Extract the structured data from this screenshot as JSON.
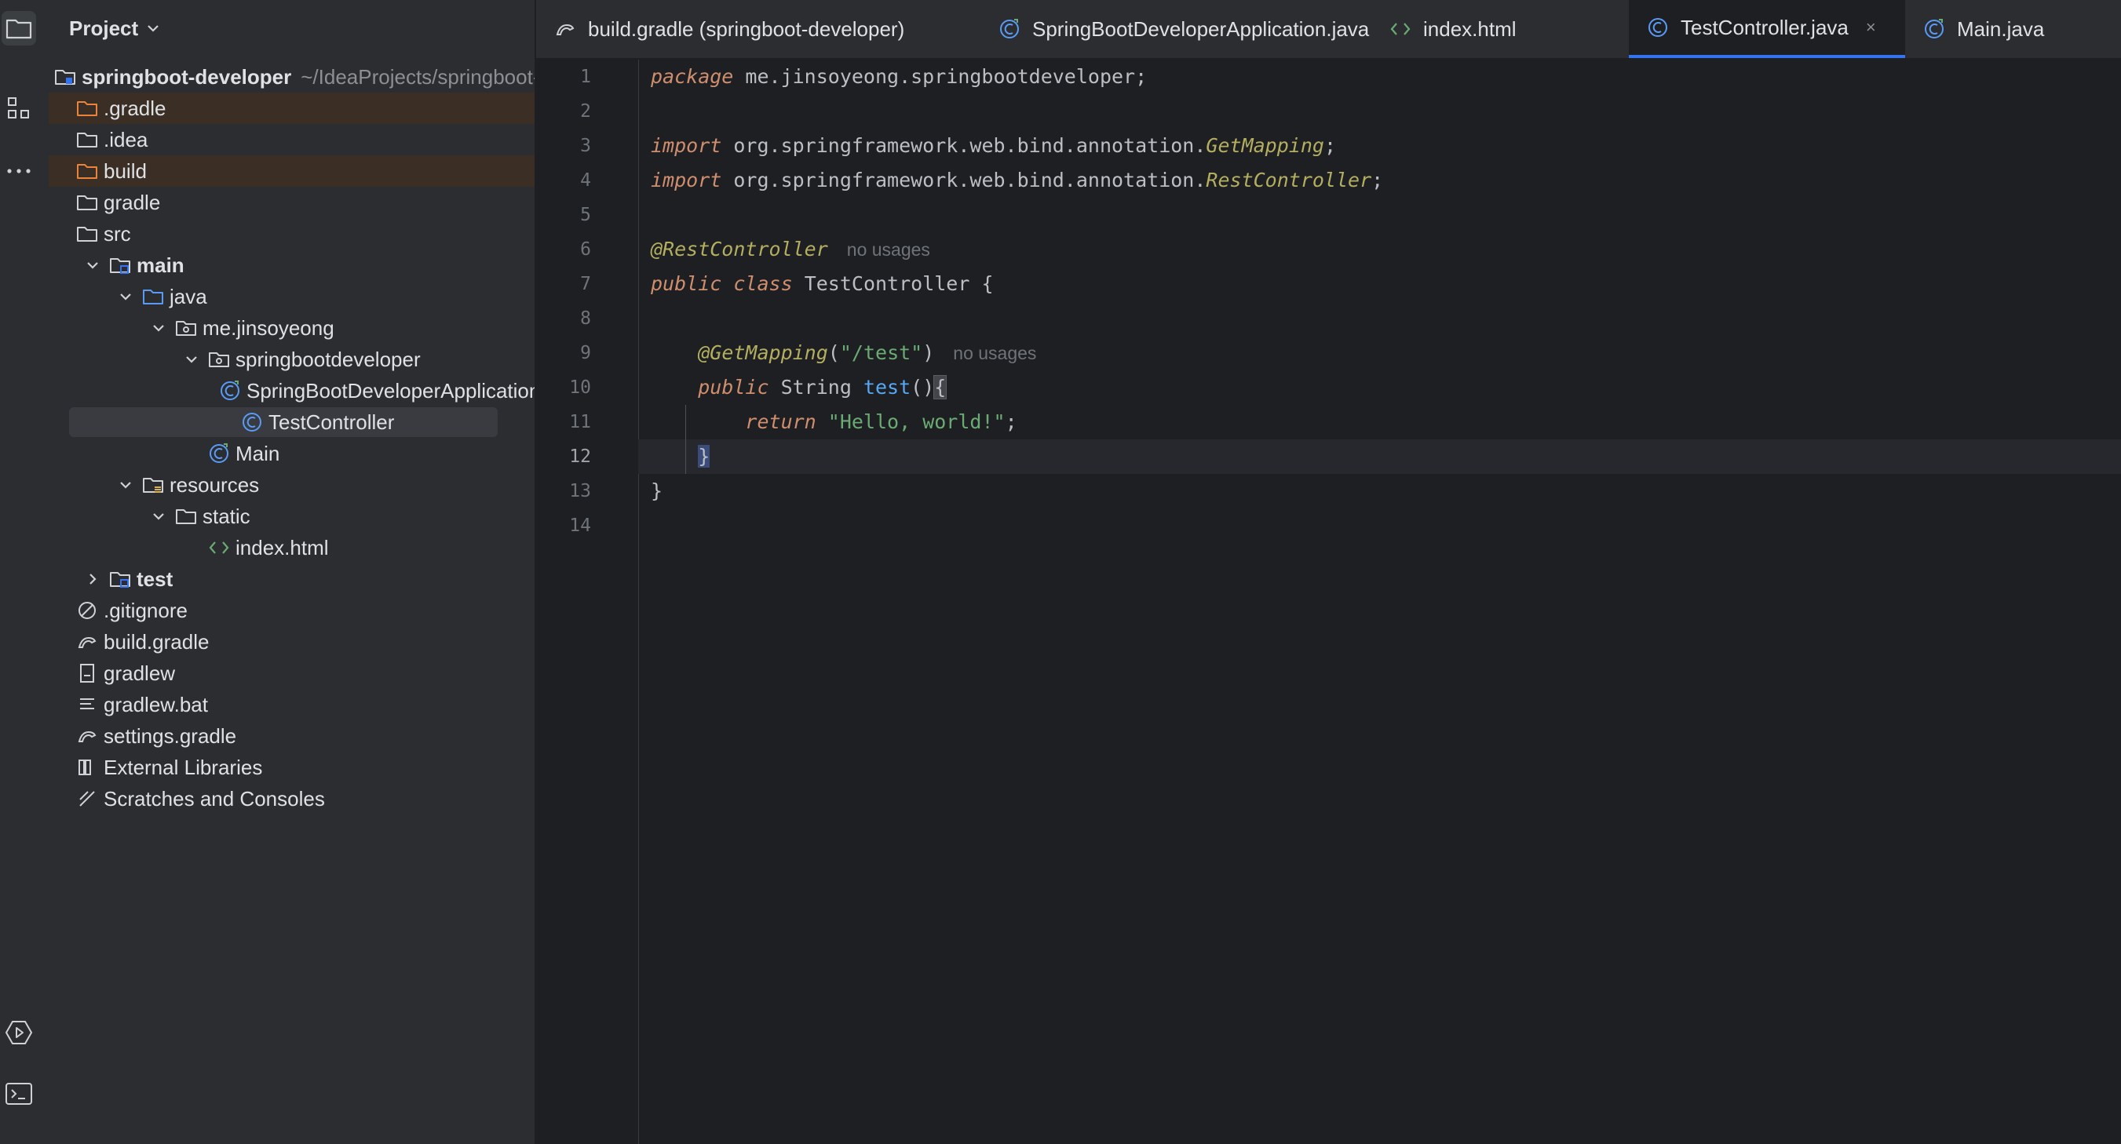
{
  "project_panel": {
    "title": "Project",
    "tree": [
      {
        "label": "springboot-developer",
        "path": "~/IdeaProjects/springboot-d",
        "depth": 0,
        "icon": "module-folder-icon",
        "bold": true,
        "excluded": false
      },
      {
        "label": ".gradle",
        "depth": 0,
        "icon": "folder-orange-icon",
        "excluded": true
      },
      {
        "label": ".idea",
        "depth": 0,
        "icon": "folder-icon"
      },
      {
        "label": "build",
        "depth": 0,
        "icon": "folder-orange-icon",
        "excluded": true
      },
      {
        "label": "gradle",
        "depth": 0,
        "icon": "folder-icon"
      },
      {
        "label": "src",
        "depth": 0,
        "icon": "folder-icon"
      },
      {
        "label": "main",
        "depth": 1,
        "icon": "source-root-folder-icon",
        "bold": true,
        "expanded": true
      },
      {
        "label": "java",
        "depth": 2,
        "icon": "java-source-folder-icon",
        "expanded": true
      },
      {
        "label": "me.jinsoyeong",
        "depth": 3,
        "icon": "package-icon",
        "expanded": true
      },
      {
        "label": "springbootdeveloper",
        "depth": 4,
        "icon": "package-icon",
        "expanded": true
      },
      {
        "label": "SpringBootDeveloperApplication",
        "depth": 5,
        "icon": "spring-boot-class-icon"
      },
      {
        "label": "TestController",
        "depth": 5,
        "icon": "java-class-icon",
        "selected": true
      },
      {
        "label": "Main",
        "depth": 4,
        "icon": "spring-boot-class-icon"
      },
      {
        "label": "resources",
        "depth": 2,
        "icon": "resources-folder-icon",
        "expanded": true
      },
      {
        "label": "static",
        "depth": 3,
        "icon": "folder-icon",
        "expanded": true
      },
      {
        "label": "index.html",
        "depth": 4,
        "icon": "html-file-icon"
      },
      {
        "label": "test",
        "depth": 1,
        "icon": "source-root-folder-icon",
        "bold": true,
        "expanded": false
      },
      {
        "label": ".gitignore",
        "depth": 0,
        "icon": "ignore-file-icon"
      },
      {
        "label": "build.gradle",
        "depth": 0,
        "icon": "gradle-file-icon"
      },
      {
        "label": "gradlew",
        "depth": 0,
        "icon": "file-icon"
      },
      {
        "label": "gradlew.bat",
        "depth": 0,
        "icon": "text-file-icon"
      },
      {
        "label": "settings.gradle",
        "depth": 0,
        "icon": "gradle-file-icon"
      },
      {
        "label": "External Libraries",
        "depth": 0,
        "icon": "libraries-icon"
      },
      {
        "label": "Scratches and Consoles",
        "depth": 0,
        "icon": "scratches-icon"
      }
    ]
  },
  "tabs": [
    {
      "label": "build.gradle (springboot-developer)",
      "icon": "gradle-file-icon",
      "active": false
    },
    {
      "label": "SpringBootDeveloperApplication.java",
      "icon": "spring-boot-class-icon",
      "active": false
    },
    {
      "label": "index.html",
      "icon": "html-file-icon",
      "active": false
    },
    {
      "label": "TestController.java",
      "icon": "java-class-icon",
      "active": true,
      "close": "×"
    },
    {
      "label": "Main.java",
      "icon": "spring-boot-class-icon",
      "active": false
    }
  ],
  "editor": {
    "current_line": 12,
    "line_numbers": [
      "1",
      "2",
      "3",
      "4",
      "5",
      "6",
      "7",
      "8",
      "9",
      "10",
      "11",
      "12",
      "13",
      "14"
    ],
    "lines": {
      "l1": {
        "kw": "package",
        "rest": " me.jinsoyeong.springbootdeveloper;"
      },
      "l3": {
        "kw": "import",
        "pkg": " org.springframework.web.bind.annotation.",
        "cls": "GetMapping",
        "end": ";"
      },
      "l4": {
        "kw": "import",
        "pkg": " org.springframework.web.bind.annotation.",
        "cls": "RestController",
        "end": ";"
      },
      "l6": {
        "ann": "@RestController",
        "hint": "no usages"
      },
      "l7": {
        "kw1": "public",
        "kw2": "class",
        "name": " TestController {"
      },
      "l9": {
        "ann": "@GetMapping",
        "open": "(",
        "str": "\"/test\"",
        "close": ")",
        "hint": "no usages"
      },
      "l10": {
        "kw": "public",
        "type": " String ",
        "fn": "test",
        "parens": "()",
        "brace": "{"
      },
      "l11": {
        "kw": "return",
        "str": " \"Hello, world!\"",
        "end": ";"
      },
      "l12": {
        "brace": "}"
      },
      "l13": {
        "brace": "}"
      }
    }
  },
  "colors": {
    "accent": "#3574f0",
    "background": "#1e1f22",
    "panel": "#2b2d30"
  }
}
